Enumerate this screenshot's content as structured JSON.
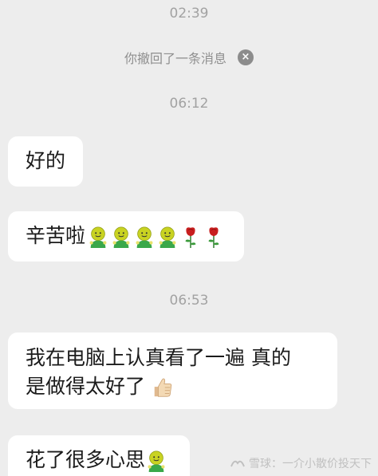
{
  "messages": {
    "t1": "02:39",
    "recall": {
      "text": "你撤回了一条消息",
      "close_icon": "×"
    },
    "t2": "06:12",
    "m1": "好的",
    "m2": {
      "text": "辛苦啦",
      "emojis": [
        "smiling-face-icon",
        "smiling-face-icon",
        "smiling-face-icon",
        "smiling-face-icon",
        "rose-icon",
        "rose-icon"
      ]
    },
    "t3": "06:53",
    "m3": {
      "line1": "我在电脑上认真看了一遍 真的",
      "line2": "是做得太好了",
      "emoji": "thumbs-up-icon"
    },
    "m4": {
      "text": "花了很多心思",
      "emoji": "smiling-face-icon"
    }
  },
  "watermark": {
    "text": "雪球：一介小散价投天下",
    "icon": "snowball-logo-icon"
  },
  "colors": {
    "background": "#ededed",
    "bubble": "#ffffff",
    "timestamp": "#a2a2a2",
    "emoji_face": "#c9d322",
    "emoji_shirt": "#3aa84a",
    "rose": "#c81e1e"
  }
}
